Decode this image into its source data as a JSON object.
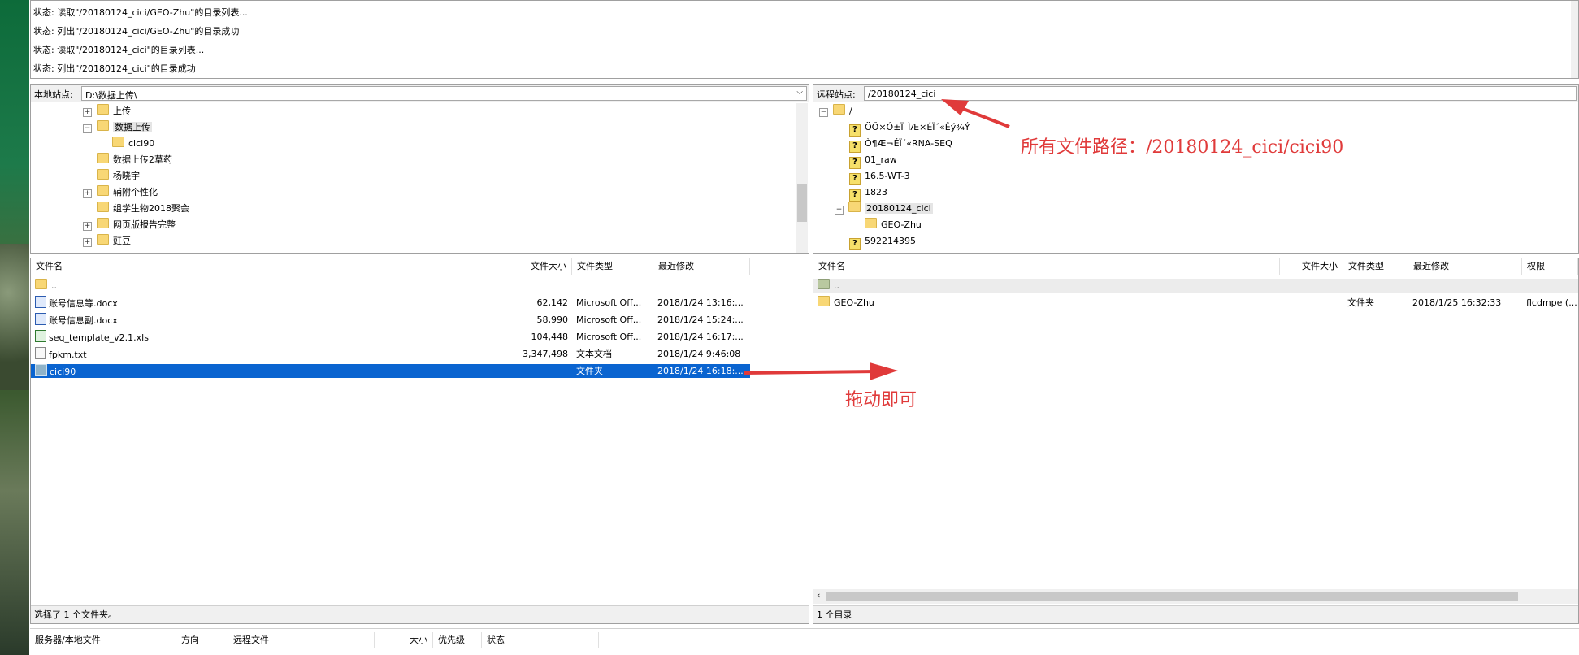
{
  "log": {
    "lines": [
      "状态: 读取\"/20180124_cici/GEO-Zhu\"的目录列表...",
      "状态: 列出\"/20180124_cici/GEO-Zhu\"的目录成功",
      "状态: 读取\"/20180124_cici\"的目录列表...",
      "状态: 列出\"/20180124_cici\"的目录成功"
    ]
  },
  "local": {
    "site_label": "本地站点:",
    "path": "D:\\数据上传\\",
    "tree": [
      {
        "label": "上传",
        "expander": "+"
      },
      {
        "label": "数据上传",
        "expander": "−"
      },
      {
        "label": "cici90",
        "expander": ""
      },
      {
        "label": "数据上传2草药",
        "expander": ""
      },
      {
        "label": "杨晓宇",
        "expander": ""
      },
      {
        "label": "辅附个性化",
        "expander": "+"
      },
      {
        "label": "组学生物2018聚会",
        "expander": ""
      },
      {
        "label": "网页版报告完整",
        "expander": "+"
      },
      {
        "label": "豇豆",
        "expander": "+"
      }
    ],
    "columns": {
      "name": "文件名",
      "size": "文件大小",
      "type": "文件类型",
      "modified": "最近修改"
    },
    "files": [
      {
        "name": "..",
        "size": "",
        "type": "",
        "modified": "",
        "icon": "folder-icon"
      },
      {
        "name": "账号信息等.docx",
        "size": "62,142",
        "type": "Microsoft Off...",
        "modified": "2018/1/24 13:16:...",
        "icon": "word-doc-icon"
      },
      {
        "name": "账号信息副.docx",
        "size": "58,990",
        "type": "Microsoft Off...",
        "modified": "2018/1/24 15:24:...",
        "icon": "word-doc-icon"
      },
      {
        "name": "seq_template_v2.1.xls",
        "size": "104,448",
        "type": "Microsoft Off...",
        "modified": "2018/1/24 16:17:...",
        "icon": "excel-icon"
      },
      {
        "name": "fpkm.txt",
        "size": "3,347,498",
        "type": "文本文档",
        "modified": "2018/1/24 9:46:08",
        "icon": "text-file-icon"
      },
      {
        "name": "cici90",
        "size": "",
        "type": "文件夹",
        "modified": "2018/1/24 16:18:...",
        "icon": "folder-icon",
        "selected": true
      }
    ],
    "status": "选择了 1 个文件夹。"
  },
  "remote": {
    "site_label": "远程站点:",
    "path": "/20180124_cici",
    "tree": [
      {
        "label": "/",
        "kind": "folder",
        "expander": "−"
      },
      {
        "label": "ÖÖ×Ó±Ï¨ÌÆ×ÉÏ´«Êý¾Ý",
        "kind": "unknown"
      },
      {
        "label": "Ò¶Æ¬ÉÏ´«RNA-SEQ",
        "kind": "unknown"
      },
      {
        "label": "01_raw",
        "kind": "unknown"
      },
      {
        "label": "16.5-WT-3",
        "kind": "unknown"
      },
      {
        "label": "1823",
        "kind": "unknown"
      },
      {
        "label": "20180124_cici",
        "kind": "folder",
        "expander": "−"
      },
      {
        "label": "GEO-Zhu",
        "kind": "folder"
      },
      {
        "label": "592214395",
        "kind": "unknown"
      }
    ],
    "columns": {
      "name": "文件名",
      "size": "文件大小",
      "type": "文件类型",
      "modified": "最近修改",
      "perms": "权限"
    },
    "files": [
      {
        "name": "..",
        "size": "",
        "type": "",
        "modified": "",
        "perms": ""
      },
      {
        "name": "GEO-Zhu",
        "size": "",
        "type": "文件夹",
        "modified": "2018/1/25 16:32:33",
        "perms": "flcdmpe (..."
      }
    ],
    "status": "1 个目录"
  },
  "queue": {
    "columns": [
      "服务器/本地文件",
      "方向",
      "远程文件",
      "大小",
      "优先级",
      "状态"
    ]
  },
  "annotations": {
    "path_note": "所有文件路径：/20180124_cici/cici90",
    "drag_note": "拖动即可",
    "color": "#e03a3a"
  }
}
